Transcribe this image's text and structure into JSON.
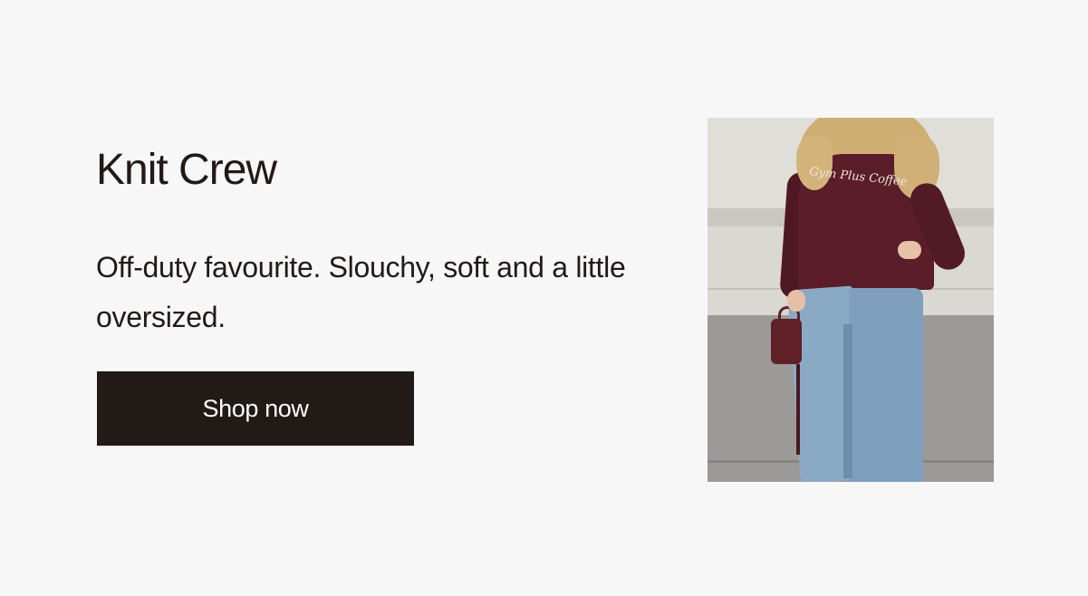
{
  "promo": {
    "title": "Knit Crew",
    "description": "Off-duty favourite. Slouchy, soft and a little oversized.",
    "cta_label": "Shop now"
  },
  "image": {
    "alt": "Model wearing a burgundy Gym Plus Coffee crew sweatshirt and light wash jeans, holding a burgundy bag",
    "sweatshirt_print": "Gym Plus Coffee"
  },
  "colors": {
    "background": "#f7f7f7",
    "text": "#211a17",
    "button_bg": "#221a17",
    "button_text": "#ffffff",
    "sweater": "#5a1d29"
  }
}
